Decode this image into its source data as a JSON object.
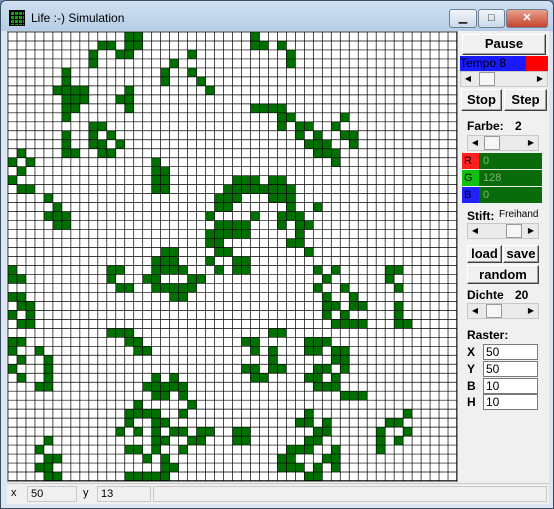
{
  "window": {
    "title": "Life :-) Simulation",
    "min_glyph": "▁",
    "max_glyph": "□",
    "close_glyph": "✕"
  },
  "controls": {
    "pause_label": "Pause",
    "tempo_label": "Tempo 8",
    "stop_label": "Stop",
    "step_label": "Step",
    "farbe_label": "Farbe:",
    "farbe_value": "2",
    "r_label": "R",
    "r_value": "0",
    "g_label": "G",
    "g_value": "128",
    "b_label": "B",
    "b_value": "0",
    "stift_label": "Stift:",
    "stift_value": "Freihand",
    "load_label": "load",
    "save_label": "save",
    "random_label": "random",
    "dichte_label": "Dichte",
    "dichte_value": "20",
    "raster_label": "Raster:",
    "x_label": "X",
    "x_value": "50",
    "y_label": "Y",
    "y_value": "50",
    "b2_label": "B",
    "b2_value": "10",
    "h_label": "H",
    "h_value": "10"
  },
  "colors": {
    "cell": "#007000",
    "tempo_bar": "#1a1aff",
    "tempo_red": "#ff0000"
  },
  "status": {
    "x_label": "x",
    "x_value": "50",
    "y_label": "y",
    "y_value": "13"
  },
  "grid": {
    "cols": 50,
    "rows": 50,
    "live": [
      [
        0,
        13
      ],
      [
        0,
        14
      ],
      [
        0,
        27
      ],
      [
        1,
        10
      ],
      [
        1,
        11
      ],
      [
        1,
        13
      ],
      [
        1,
        14
      ],
      [
        1,
        27
      ],
      [
        1,
        28
      ],
      [
        1,
        30
      ],
      [
        2,
        9
      ],
      [
        2,
        12
      ],
      [
        2,
        13
      ],
      [
        2,
        20
      ],
      [
        2,
        31
      ],
      [
        3,
        9
      ],
      [
        3,
        18
      ],
      [
        3,
        31
      ],
      [
        4,
        6
      ],
      [
        4,
        17
      ],
      [
        4,
        20
      ],
      [
        5,
        6
      ],
      [
        5,
        17
      ],
      [
        5,
        21
      ],
      [
        6,
        5
      ],
      [
        6,
        6
      ],
      [
        6,
        7
      ],
      [
        6,
        8
      ],
      [
        6,
        13
      ],
      [
        6,
        22
      ],
      [
        7,
        6
      ],
      [
        7,
        7
      ],
      [
        7,
        8
      ],
      [
        7,
        12
      ],
      [
        7,
        13
      ],
      [
        8,
        6
      ],
      [
        8,
        7
      ],
      [
        8,
        13
      ],
      [
        8,
        27
      ],
      [
        8,
        28
      ],
      [
        8,
        29
      ],
      [
        8,
        30
      ],
      [
        9,
        6
      ],
      [
        9,
        30
      ],
      [
        9,
        31
      ],
      [
        9,
        37
      ],
      [
        10,
        9
      ],
      [
        10,
        10
      ],
      [
        10,
        30
      ],
      [
        10,
        32
      ],
      [
        10,
        33
      ],
      [
        10,
        36
      ],
      [
        11,
        6
      ],
      [
        11,
        9
      ],
      [
        11,
        11
      ],
      [
        11,
        32
      ],
      [
        11,
        34
      ],
      [
        11,
        37
      ],
      [
        11,
        38
      ],
      [
        12,
        6
      ],
      [
        12,
        9
      ],
      [
        12,
        10
      ],
      [
        12,
        12
      ],
      [
        12,
        33
      ],
      [
        12,
        34
      ],
      [
        12,
        35
      ],
      [
        12,
        38
      ],
      [
        13,
        1
      ],
      [
        13,
        6
      ],
      [
        13,
        7
      ],
      [
        13,
        10
      ],
      [
        13,
        11
      ],
      [
        13,
        34
      ],
      [
        13,
        35
      ],
      [
        13,
        36
      ],
      [
        14,
        0
      ],
      [
        14,
        2
      ],
      [
        14,
        16
      ],
      [
        14,
        36
      ],
      [
        15,
        1
      ],
      [
        15,
        16
      ],
      [
        15,
        17
      ],
      [
        16,
        0
      ],
      [
        16,
        16
      ],
      [
        16,
        17
      ],
      [
        16,
        25
      ],
      [
        16,
        26
      ],
      [
        16,
        27
      ],
      [
        16,
        29
      ],
      [
        16,
        30
      ],
      [
        17,
        1
      ],
      [
        17,
        2
      ],
      [
        17,
        16
      ],
      [
        17,
        17
      ],
      [
        17,
        24
      ],
      [
        17,
        25
      ],
      [
        17,
        26
      ],
      [
        17,
        27
      ],
      [
        17,
        28
      ],
      [
        17,
        29
      ],
      [
        17,
        30
      ],
      [
        17,
        31
      ],
      [
        18,
        4
      ],
      [
        18,
        23
      ],
      [
        18,
        24
      ],
      [
        18,
        25
      ],
      [
        18,
        29
      ],
      [
        18,
        30
      ],
      [
        18,
        31
      ],
      [
        19,
        5
      ],
      [
        19,
        23
      ],
      [
        19,
        24
      ],
      [
        19,
        31
      ],
      [
        19,
        34
      ],
      [
        20,
        4
      ],
      [
        20,
        5
      ],
      [
        20,
        6
      ],
      [
        20,
        22
      ],
      [
        20,
        27
      ],
      [
        20,
        30
      ],
      [
        20,
        31
      ],
      [
        20,
        32
      ],
      [
        21,
        5
      ],
      [
        21,
        6
      ],
      [
        21,
        23
      ],
      [
        21,
        24
      ],
      [
        21,
        25
      ],
      [
        21,
        26
      ],
      [
        21,
        30
      ],
      [
        21,
        32
      ],
      [
        21,
        33
      ],
      [
        22,
        22
      ],
      [
        22,
        23
      ],
      [
        22,
        24
      ],
      [
        22,
        25
      ],
      [
        22,
        26
      ],
      [
        22,
        32
      ],
      [
        23,
        22
      ],
      [
        23,
        23
      ],
      [
        23,
        31
      ],
      [
        23,
        32
      ],
      [
        24,
        17
      ],
      [
        24,
        18
      ],
      [
        24,
        23
      ],
      [
        24,
        24
      ],
      [
        24,
        33
      ],
      [
        25,
        16
      ],
      [
        25,
        17
      ],
      [
        25,
        18
      ],
      [
        25,
        22
      ],
      [
        25,
        25
      ],
      [
        25,
        26
      ],
      [
        26,
        0
      ],
      [
        26,
        11
      ],
      [
        26,
        12
      ],
      [
        26,
        16
      ],
      [
        26,
        17
      ],
      [
        26,
        18
      ],
      [
        26,
        19
      ],
      [
        26,
        23
      ],
      [
        26,
        25
      ],
      [
        26,
        26
      ],
      [
        26,
        34
      ],
      [
        26,
        36
      ],
      [
        26,
        42
      ],
      [
        26,
        43
      ],
      [
        27,
        0
      ],
      [
        27,
        1
      ],
      [
        27,
        11
      ],
      [
        27,
        15
      ],
      [
        27,
        16
      ],
      [
        27,
        20
      ],
      [
        27,
        21
      ],
      [
        27,
        35
      ],
      [
        27,
        42
      ],
      [
        28,
        12
      ],
      [
        28,
        13
      ],
      [
        28,
        16
      ],
      [
        28,
        17
      ],
      [
        28,
        18
      ],
      [
        28,
        19
      ],
      [
        28,
        20
      ],
      [
        28,
        34
      ],
      [
        28,
        37
      ],
      [
        28,
        43
      ],
      [
        29,
        0
      ],
      [
        29,
        1
      ],
      [
        29,
        18
      ],
      [
        29,
        19
      ],
      [
        29,
        35
      ],
      [
        29,
        38
      ],
      [
        30,
        1
      ],
      [
        30,
        2
      ],
      [
        30,
        35
      ],
      [
        30,
        36
      ],
      [
        30,
        38
      ],
      [
        30,
        39
      ],
      [
        30,
        43
      ],
      [
        31,
        0
      ],
      [
        31,
        2
      ],
      [
        31,
        35
      ],
      [
        31,
        37
      ],
      [
        31,
        43
      ],
      [
        32,
        1
      ],
      [
        32,
        2
      ],
      [
        32,
        36
      ],
      [
        32,
        37
      ],
      [
        32,
        38
      ],
      [
        32,
        39
      ],
      [
        32,
        43
      ],
      [
        32,
        44
      ],
      [
        33,
        11
      ],
      [
        33,
        12
      ],
      [
        33,
        13
      ],
      [
        33,
        29
      ],
      [
        33,
        30
      ],
      [
        34,
        0
      ],
      [
        34,
        1
      ],
      [
        34,
        13
      ],
      [
        34,
        14
      ],
      [
        34,
        26
      ],
      [
        34,
        27
      ],
      [
        34,
        33
      ],
      [
        34,
        34
      ],
      [
        34,
        35
      ],
      [
        35,
        0
      ],
      [
        35,
        3
      ],
      [
        35,
        14
      ],
      [
        35,
        15
      ],
      [
        35,
        27
      ],
      [
        35,
        29
      ],
      [
        35,
        33
      ],
      [
        35,
        34
      ],
      [
        35,
        36
      ],
      [
        35,
        37
      ],
      [
        36,
        1
      ],
      [
        36,
        4
      ],
      [
        36,
        29
      ],
      [
        36,
        36
      ],
      [
        36,
        37
      ],
      [
        37,
        0
      ],
      [
        37,
        4
      ],
      [
        37,
        26
      ],
      [
        37,
        27
      ],
      [
        37,
        29
      ],
      [
        37,
        30
      ],
      [
        37,
        34
      ],
      [
        37,
        35
      ],
      [
        37,
        37
      ],
      [
        38,
        1
      ],
      [
        38,
        4
      ],
      [
        38,
        16
      ],
      [
        38,
        18
      ],
      [
        38,
        27
      ],
      [
        38,
        28
      ],
      [
        38,
        33
      ],
      [
        38,
        34
      ],
      [
        38,
        36
      ],
      [
        39,
        3
      ],
      [
        39,
        4
      ],
      [
        39,
        15
      ],
      [
        39,
        16
      ],
      [
        39,
        17
      ],
      [
        39,
        18
      ],
      [
        39,
        19
      ],
      [
        39,
        34
      ],
      [
        39,
        35
      ],
      [
        39,
        36
      ],
      [
        40,
        16
      ],
      [
        40,
        17
      ],
      [
        40,
        19
      ],
      [
        40,
        37
      ],
      [
        40,
        38
      ],
      [
        40,
        39
      ],
      [
        41,
        14
      ],
      [
        41,
        20
      ],
      [
        42,
        13
      ],
      [
        42,
        14
      ],
      [
        42,
        15
      ],
      [
        42,
        16
      ],
      [
        42,
        19
      ],
      [
        42,
        33
      ],
      [
        42,
        44
      ],
      [
        43,
        13
      ],
      [
        43,
        16
      ],
      [
        43,
        17
      ],
      [
        43,
        32
      ],
      [
        43,
        33
      ],
      [
        43,
        35
      ],
      [
        43,
        42
      ],
      [
        43,
        43
      ],
      [
        44,
        12
      ],
      [
        44,
        14
      ],
      [
        44,
        16
      ],
      [
        44,
        18
      ],
      [
        44,
        19
      ],
      [
        44,
        21
      ],
      [
        44,
        22
      ],
      [
        44,
        25
      ],
      [
        44,
        26
      ],
      [
        44,
        34
      ],
      [
        44,
        35
      ],
      [
        44,
        41
      ],
      [
        44,
        44
      ],
      [
        45,
        4
      ],
      [
        45,
        16
      ],
      [
        45,
        17
      ],
      [
        45,
        20
      ],
      [
        45,
        21
      ],
      [
        45,
        25
      ],
      [
        45,
        26
      ],
      [
        45,
        33
      ],
      [
        45,
        34
      ],
      [
        45,
        41
      ],
      [
        45,
        43
      ],
      [
        46,
        3
      ],
      [
        46,
        13
      ],
      [
        46,
        14
      ],
      [
        46,
        16
      ],
      [
        46,
        19
      ],
      [
        46,
        31
      ],
      [
        46,
        32
      ],
      [
        46,
        33
      ],
      [
        46,
        36
      ],
      [
        46,
        41
      ],
      [
        47,
        4
      ],
      [
        47,
        5
      ],
      [
        47,
        15
      ],
      [
        47,
        17
      ],
      [
        47,
        30
      ],
      [
        47,
        31
      ],
      [
        47,
        35
      ],
      [
        47,
        36
      ],
      [
        48,
        3
      ],
      [
        48,
        4
      ],
      [
        48,
        17
      ],
      [
        48,
        18
      ],
      [
        48,
        30
      ],
      [
        48,
        31
      ],
      [
        48,
        32
      ],
      [
        48,
        34
      ],
      [
        48,
        36
      ],
      [
        49,
        4
      ],
      [
        49,
        5
      ],
      [
        49,
        13
      ],
      [
        49,
        14
      ],
      [
        49,
        15
      ],
      [
        49,
        16
      ],
      [
        49,
        17
      ],
      [
        49,
        33
      ],
      [
        49,
        34
      ]
    ]
  }
}
